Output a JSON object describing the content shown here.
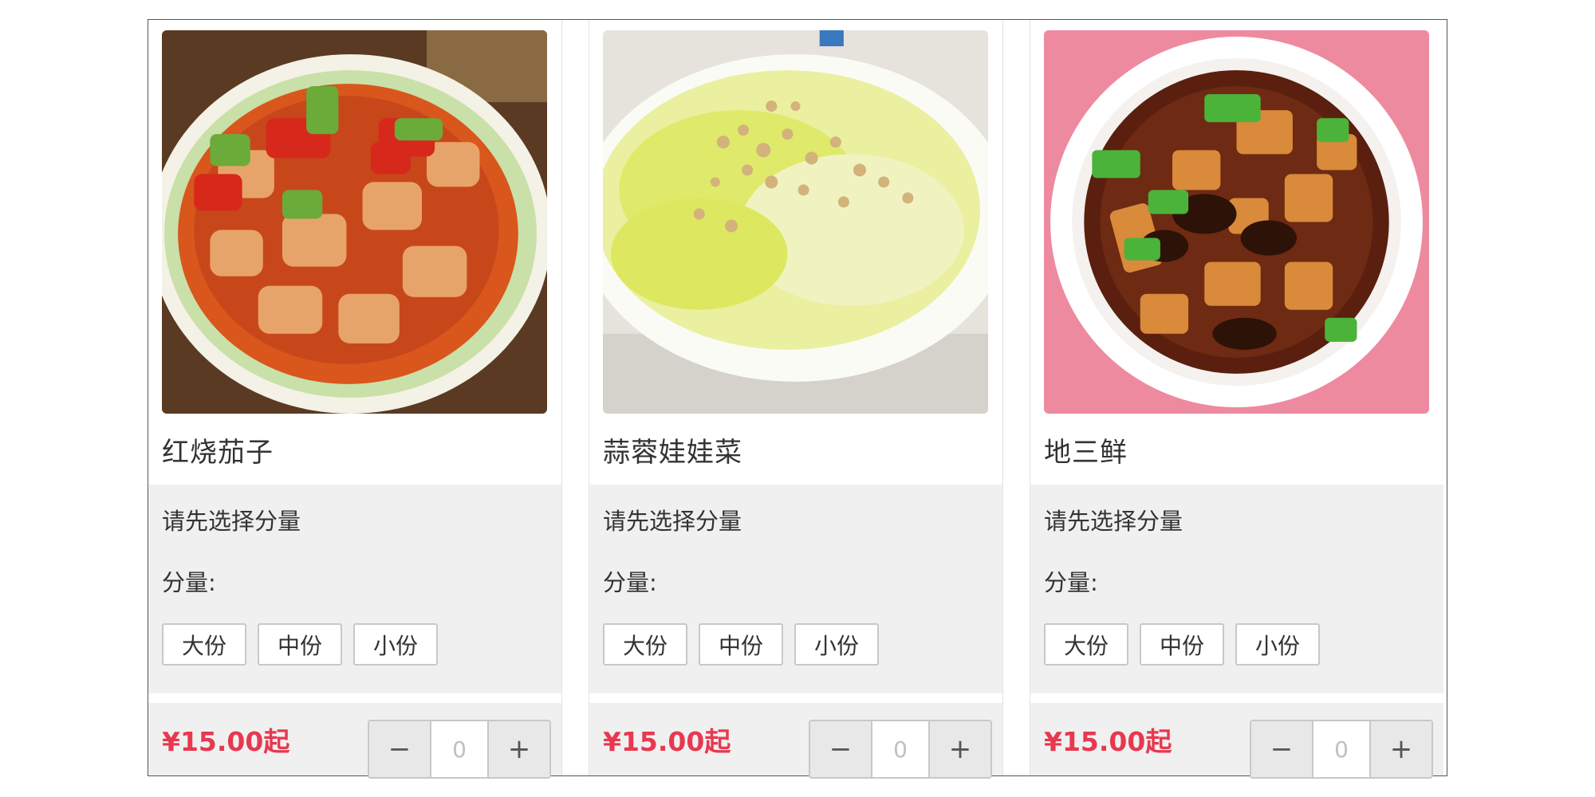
{
  "colors": {
    "price": "#e8384f",
    "panel_bg": "#f0f0f0",
    "text": "#333333"
  },
  "dishes": [
    {
      "name": "红烧茄子",
      "spec_hint": "请先选择分量",
      "spec_label": "分量:",
      "options": [
        "大份",
        "中份",
        "小份"
      ],
      "price": "¥15.00起",
      "quantity": "0",
      "minus_label": "−",
      "plus_label": "+"
    },
    {
      "name": "蒜蓉娃娃菜",
      "spec_hint": "请先选择分量",
      "spec_label": "分量:",
      "options": [
        "大份",
        "中份",
        "小份"
      ],
      "price": "¥15.00起",
      "quantity": "0",
      "minus_label": "−",
      "plus_label": "+"
    },
    {
      "name": "地三鲜",
      "spec_hint": "请先选择分量",
      "spec_label": "分量:",
      "options": [
        "大份",
        "中份",
        "小份"
      ],
      "price": "¥15.00起",
      "quantity": "0",
      "minus_label": "−",
      "plus_label": "+"
    }
  ]
}
